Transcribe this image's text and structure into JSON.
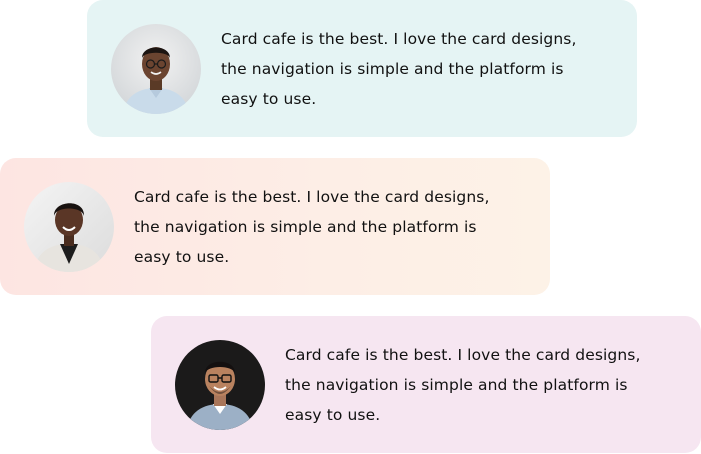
{
  "testimonials": [
    {
      "quote": "Card cafe is the best. I love the card designs, the navigation is simple and the platform is easy to use.",
      "background": "#e5f4f4",
      "avatar_icon": "person-avatar-1"
    },
    {
      "quote": "Card cafe is the best. I love the card designs, the navigation is simple and the platform is easy to use.",
      "background": "#fde9e3",
      "avatar_icon": "person-avatar-2"
    },
    {
      "quote": "Card cafe is the best. I love the card designs, the navigation is simple and the platform is easy to use.",
      "background": "#f6e6f1",
      "avatar_icon": "person-avatar-3"
    }
  ]
}
